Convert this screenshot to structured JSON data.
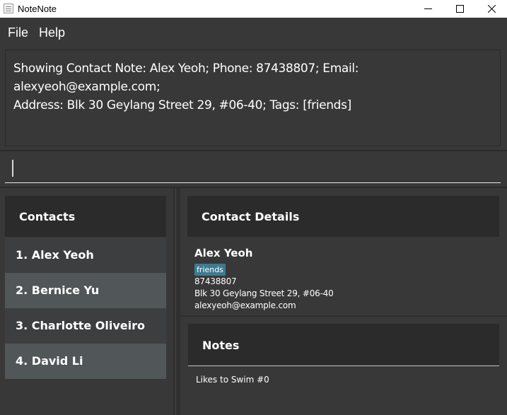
{
  "window": {
    "title": "NoteNote"
  },
  "menu": {
    "file": "File",
    "help": "Help"
  },
  "result": {
    "line1": "Showing Contact Note: Alex Yeoh; Phone: 87438807; Email: alexyeoh@example.com;",
    "line2": "Address: Blk 30 Geylang Street 29, #06-40; Tags: [friends]"
  },
  "command": {
    "value": ""
  },
  "contacts": {
    "header": "Contacts",
    "items": [
      "1.  Alex Yeoh",
      "2.  Bernice Yu",
      "3.  Charlotte Oliveiro",
      "4.  David Li"
    ]
  },
  "details": {
    "header": "Contact Details",
    "name": "Alex Yeoh",
    "tag": "friends",
    "phone": "87438807",
    "address": "Blk 30 Geylang Street 29, #06-40",
    "email": "alexyeoh@example.com"
  },
  "notes": {
    "header": "Notes",
    "items": [
      "Likes to Swim #0"
    ]
  },
  "colors": {
    "background": "#383838",
    "header": "#2b2b2b",
    "row_dark": "#3c3e3f",
    "row_light": "#515658",
    "tag": "#3e7b91"
  }
}
